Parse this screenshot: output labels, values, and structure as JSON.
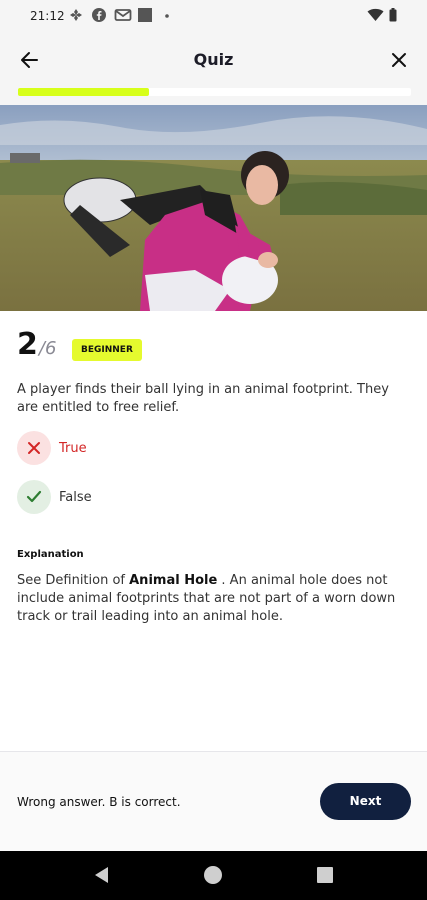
{
  "status_bar": {
    "time": "21:12"
  },
  "header": {
    "title": "Quiz"
  },
  "progress": {
    "current": 2,
    "total": 6,
    "fraction": 0.333,
    "color": "#d7ff1a"
  },
  "question": {
    "number": "2",
    "total_label": "/6",
    "level": "BEGINNER",
    "text": "A player finds their ball lying in an animal footprint. They are entitled to free relief."
  },
  "options": [
    {
      "label": "True",
      "state": "wrong",
      "icon": "x-icon",
      "color": "#d32626"
    },
    {
      "label": "False",
      "state": "correct",
      "icon": "check-icon",
      "color": "#2e7d32"
    }
  ],
  "explanation": {
    "title": "Explanation",
    "prefix": "See Definition of ",
    "term": "Animal Hole",
    "body": " . An animal hole does not include animal footprints that are not part of a worn down track or trail leading into an animal hole."
  },
  "footer": {
    "result_text": "Wrong answer. B is correct.",
    "next_label": "Next"
  },
  "colors": {
    "accent": "#e5fa2e",
    "button": "#11203f"
  }
}
